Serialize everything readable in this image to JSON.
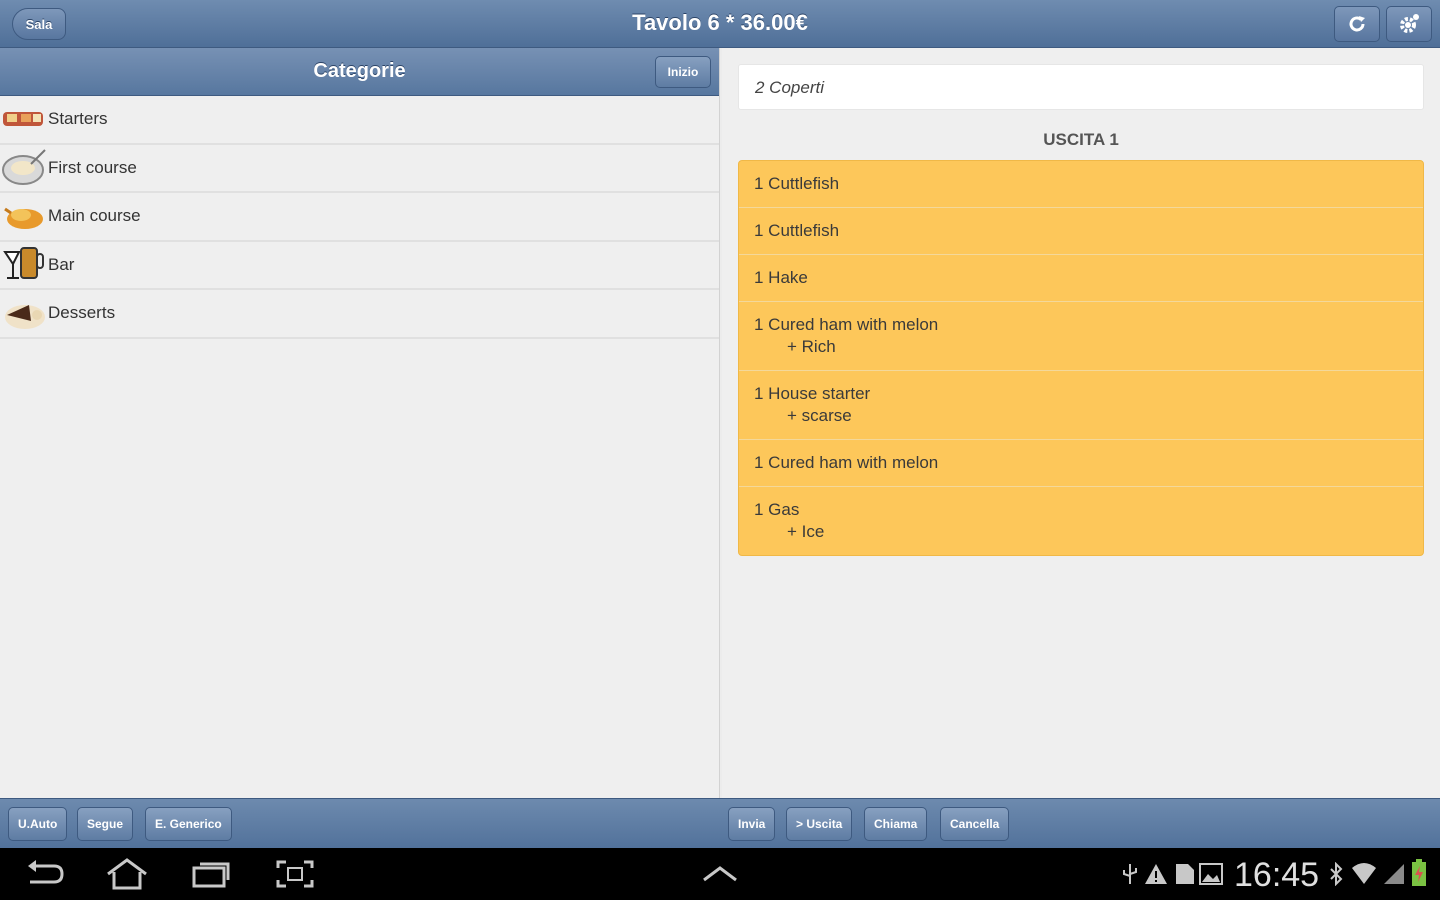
{
  "header": {
    "back_label": "Sala",
    "title": "Tavolo 6 * 36.00€"
  },
  "categories": {
    "title": "Categorie",
    "inizio_label": "Inizio",
    "items": [
      {
        "label": "Starters",
        "icon": "starters-icon"
      },
      {
        "label": "First course",
        "icon": "first-course-icon"
      },
      {
        "label": "Main course",
        "icon": "main-course-icon"
      },
      {
        "label": "Bar",
        "icon": "bar-icon"
      },
      {
        "label": "Desserts",
        "icon": "desserts-icon"
      }
    ]
  },
  "order": {
    "covers": "2 Coperti",
    "section_title": "USCITA 1",
    "items": [
      {
        "text": "1 Cuttlefish",
        "modifier": ""
      },
      {
        "text": "1 Cuttlefish",
        "modifier": ""
      },
      {
        "text": "1 Hake",
        "modifier": ""
      },
      {
        "text": "1 Cured ham with melon",
        "modifier": "+ Rich"
      },
      {
        "text": "1 House starter",
        "modifier": "+ scarse"
      },
      {
        "text": "1 Cured ham with melon",
        "modifier": ""
      },
      {
        "text": "1 Gas",
        "modifier": "+ Ice"
      }
    ]
  },
  "toolbar": {
    "left": [
      "U.Auto",
      "Segue",
      "E. Generico"
    ],
    "right": [
      "Invia",
      "> Uscita",
      "Chiama",
      "Cancella"
    ]
  },
  "system": {
    "time": "16:45"
  },
  "colors": {
    "header": "#5a789f",
    "order_bg": "#fdc75a"
  }
}
